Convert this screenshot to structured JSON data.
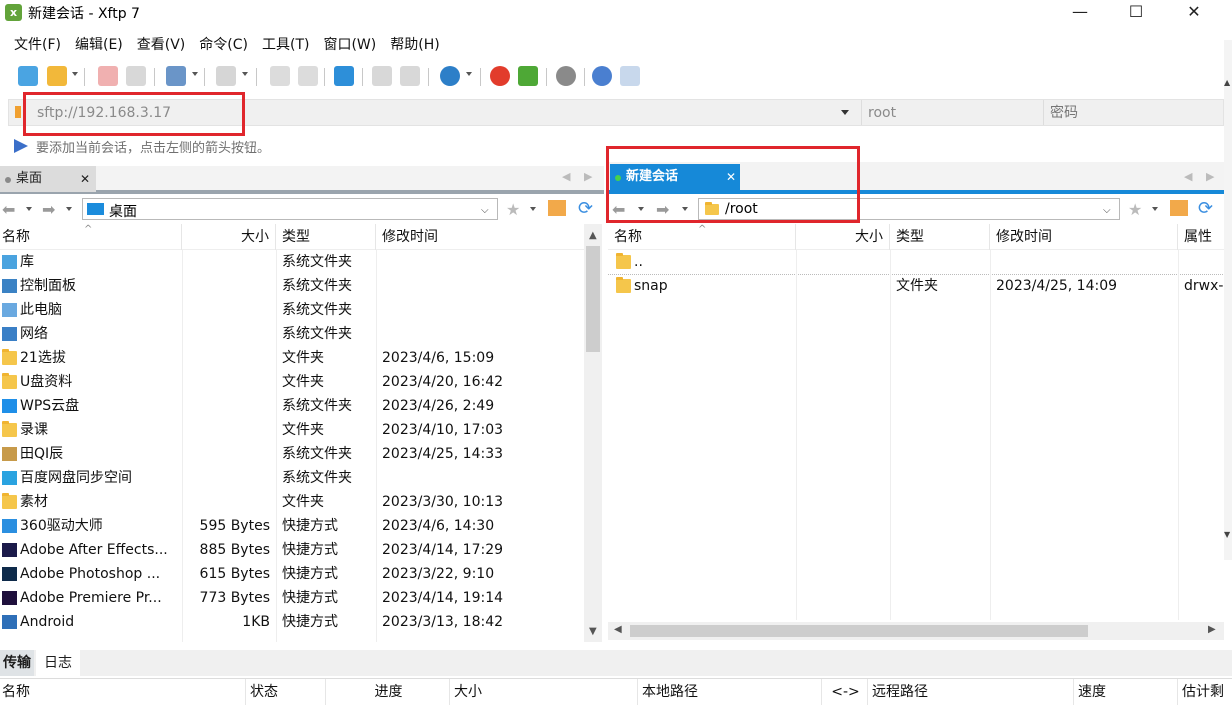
{
  "window": {
    "title": "新建会话 - Xftp 7",
    "minimize": "—",
    "maximize": "☐",
    "close": "✕",
    "app_icon_letter": "x"
  },
  "menu": [
    "文件(F)",
    "编辑(E)",
    "查看(V)",
    "命令(C)",
    "工具(T)",
    "窗口(W)",
    "帮助(H)"
  ],
  "address": {
    "value": "sftp://192.168.3.17",
    "user": "root",
    "password_placeholder": "密码"
  },
  "hint": "要添加当前会话，点击左侧的箭头按钮。",
  "left": {
    "tab_label": "桌面",
    "path": "桌面",
    "columns": [
      "名称",
      "大小",
      "类型",
      "修改时间"
    ],
    "rows": [
      {
        "name": "库",
        "size": "",
        "type": "系统文件夹",
        "date": "",
        "icon": "library-icon"
      },
      {
        "name": "控制面板",
        "size": "",
        "type": "系统文件夹",
        "date": "",
        "icon": "control-panel-icon"
      },
      {
        "name": "此电脑",
        "size": "",
        "type": "系统文件夹",
        "date": "",
        "icon": "computer-icon"
      },
      {
        "name": "网络",
        "size": "",
        "type": "系统文件夹",
        "date": "",
        "icon": "network-icon"
      },
      {
        "name": "21选拔",
        "size": "",
        "type": "文件夹",
        "date": "2023/4/6, 15:09",
        "icon": "folder-icon"
      },
      {
        "name": "U盘资料",
        "size": "",
        "type": "文件夹",
        "date": "2023/4/20, 16:42",
        "icon": "folder-icon"
      },
      {
        "name": "WPS云盘",
        "size": "",
        "type": "系统文件夹",
        "date": "2023/4/26, 2:49",
        "icon": "cloud-icon"
      },
      {
        "name": "录课",
        "size": "",
        "type": "文件夹",
        "date": "2023/4/10, 17:03",
        "icon": "folder-icon"
      },
      {
        "name": "田QI辰",
        "size": "",
        "type": "系统文件夹",
        "date": "2023/4/25, 14:33",
        "icon": "user-folder-icon"
      },
      {
        "name": "百度网盘同步空间",
        "size": "",
        "type": "系统文件夹",
        "date": "",
        "icon": "sync-folder-icon"
      },
      {
        "name": "素材",
        "size": "",
        "type": "文件夹",
        "date": "2023/3/30, 10:13",
        "icon": "folder-icon"
      },
      {
        "name": "360驱动大师",
        "size": "595 Bytes",
        "type": "快捷方式",
        "date": "2023/4/6, 14:30",
        "icon": "shortcut-360-icon"
      },
      {
        "name": "Adobe After Effects...",
        "size": "885 Bytes",
        "type": "快捷方式",
        "date": "2023/4/14, 17:29",
        "icon": "after-effects-icon"
      },
      {
        "name": "Adobe Photoshop ...",
        "size": "615 Bytes",
        "type": "快捷方式",
        "date": "2023/3/22, 9:10",
        "icon": "photoshop-icon"
      },
      {
        "name": "Adobe Premiere Pr...",
        "size": "773 Bytes",
        "type": "快捷方式",
        "date": "2023/4/14, 19:14",
        "icon": "premiere-icon"
      },
      {
        "name": "Android",
        "size": "1KB",
        "type": "快捷方式",
        "date": "2023/3/13, 18:42",
        "icon": "android-icon"
      }
    ]
  },
  "right": {
    "tab_label": "新建会话",
    "path": "/root",
    "columns": [
      "名称",
      "大小",
      "类型",
      "修改时间",
      "属性"
    ],
    "rows": [
      {
        "name": "..",
        "size": "",
        "type": "",
        "date": "",
        "attr": ""
      },
      {
        "name": "snap",
        "size": "",
        "type": "文件夹",
        "date": "2023/4/25, 14:09",
        "attr": "drwx-"
      }
    ]
  },
  "bottom": {
    "tabs": [
      "传输",
      "日志"
    ],
    "columns": [
      "名称",
      "状态",
      "进度",
      "大小",
      "本地路径",
      "<->",
      "远程路径",
      "速度",
      "估计剩"
    ]
  },
  "colors": {
    "accent": "#1e90d8",
    "highlight_box": "#e0262c",
    "tab_active": "#1689d8"
  }
}
